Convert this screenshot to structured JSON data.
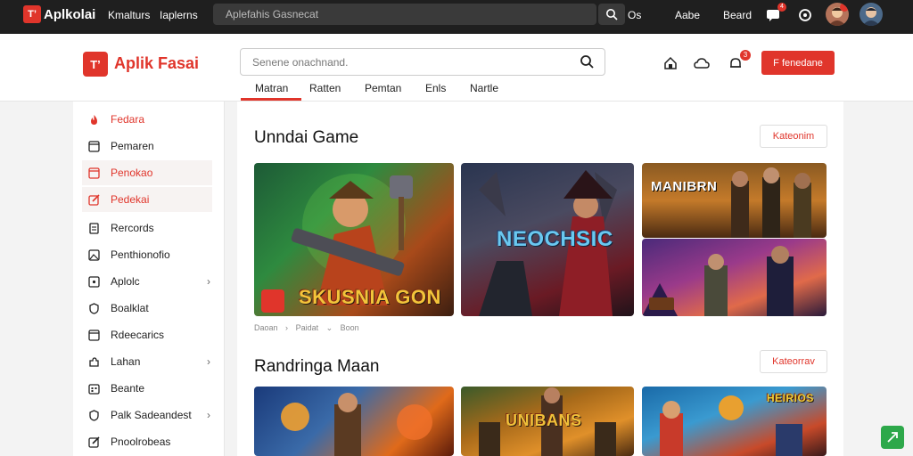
{
  "topbar": {
    "logo": "T’",
    "brand": "Aplkolai",
    "links": [
      "Kmalturs",
      "Iaplerns"
    ],
    "search_placeholder": "Aplefahis Gasnecat",
    "search_suffix": "Os",
    "right_links": [
      "Aabe",
      "Beard"
    ],
    "badge": "4"
  },
  "header": {
    "logo": "T’",
    "brand": "Aplik Fasai",
    "search_placeholder": "Senene onachnand.",
    "button_label": "F fenedane",
    "notif_badge": "3",
    "tabs": [
      "Matran",
      "Ratten",
      "Pemtan",
      "Enls",
      "Nartle"
    ]
  },
  "sidebar": {
    "items": [
      {
        "label": "Fedara"
      },
      {
        "label": "Pemaren"
      },
      {
        "label": "Penokao"
      },
      {
        "label": "Pedekai"
      },
      {
        "label": "Rercords"
      },
      {
        "label": "Penthionofio"
      },
      {
        "label": "Aplolc"
      },
      {
        "label": "Boalklat"
      },
      {
        "label": "Rdeecarics"
      },
      {
        "label": "Lahan"
      },
      {
        "label": "Beante"
      },
      {
        "label": "Palk Sadeandest"
      },
      {
        "label": "Pnoolrobeas"
      }
    ]
  },
  "main": {
    "section1": {
      "title": "Unndai Game",
      "button": "Kateonim",
      "cards": [
        {
          "title": "SKUSNIA GON"
        },
        {
          "title": "NEOCHSIC"
        },
        {
          "title": "MANIBRN"
        },
        {
          "title": ""
        }
      ],
      "crumbs": [
        "Daoan",
        "Paidat",
        "Boon"
      ]
    },
    "section2": {
      "title": "Randringa Maan",
      "button": "Kateorrav",
      "cards": [
        {
          "title": ""
        },
        {
          "title": "UNIBANS"
        },
        {
          "title": "HEIRIOS"
        }
      ]
    }
  },
  "colors": {
    "accent": "#e0352b",
    "topbar": "#1f1f1f",
    "fab": "#2da84a"
  }
}
